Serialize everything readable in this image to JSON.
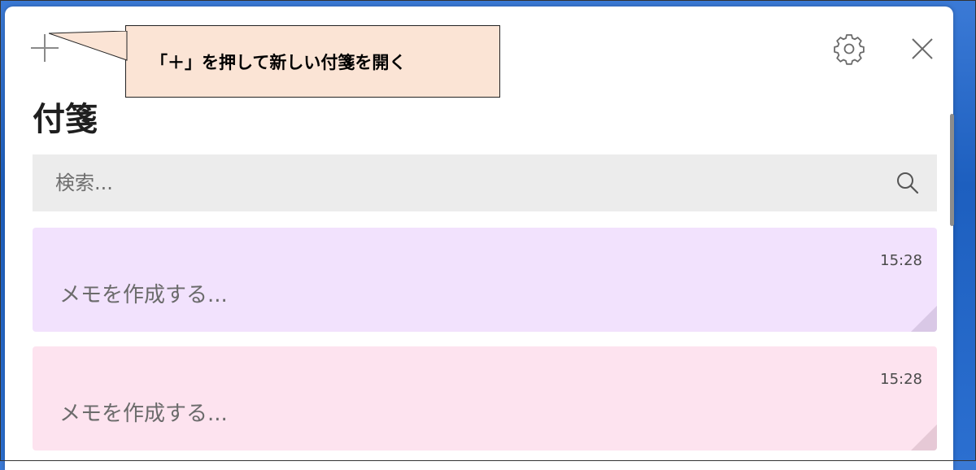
{
  "window": {
    "title": "付箋"
  },
  "toolbar": {
    "add_icon": "plus-icon",
    "settings_icon": "gear-icon",
    "close_icon": "close-icon"
  },
  "callout": {
    "text": "「＋」を押して新しい付箋を開く"
  },
  "search": {
    "placeholder": "検索...",
    "icon": "search-icon"
  },
  "notes": [
    {
      "time": "15:28",
      "text": "メモを作成する...",
      "color": "#f2e2fd",
      "fold_color": "#d9c8e6"
    },
    {
      "time": "15:28",
      "text": "メモを作成する...",
      "color": "#fde3ef",
      "fold_color": "#e6c9d6"
    }
  ]
}
